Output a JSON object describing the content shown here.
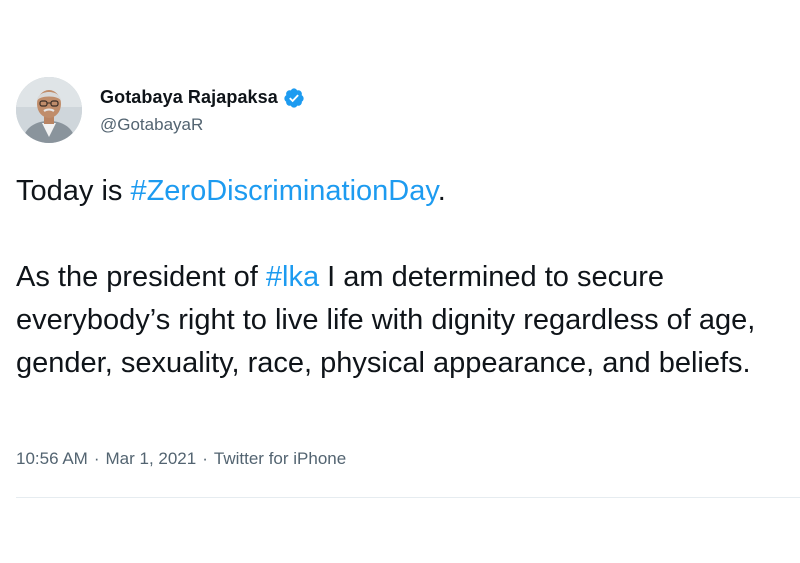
{
  "author": {
    "display_name": "Gotabaya Rajapaksa",
    "handle": "@GotabayaR",
    "avatar_icon": "profile-photo",
    "verified_icon": "verified-badge-icon",
    "verified_color": "#1d9bf0"
  },
  "tweet": {
    "line1_prefix": "Today is ",
    "line1_hashtag": "#ZeroDiscriminationDay",
    "line1_suffix": ".",
    "para2_prefix": "As the president of ",
    "para2_hashtag": "#lka",
    "para2_rest": " I am determined to secure everybody’s right to live life with dignity regardless of age, gender, sexuality, race, physical appearance, and beliefs."
  },
  "meta": {
    "time": "10:56 AM",
    "separator": "·",
    "date": "Mar 1, 2021",
    "source": "Twitter for iPhone"
  },
  "colors": {
    "text": "#0f1419",
    "secondary": "#536471",
    "link": "#1d9bf0",
    "divider": "#e6ecf0"
  }
}
